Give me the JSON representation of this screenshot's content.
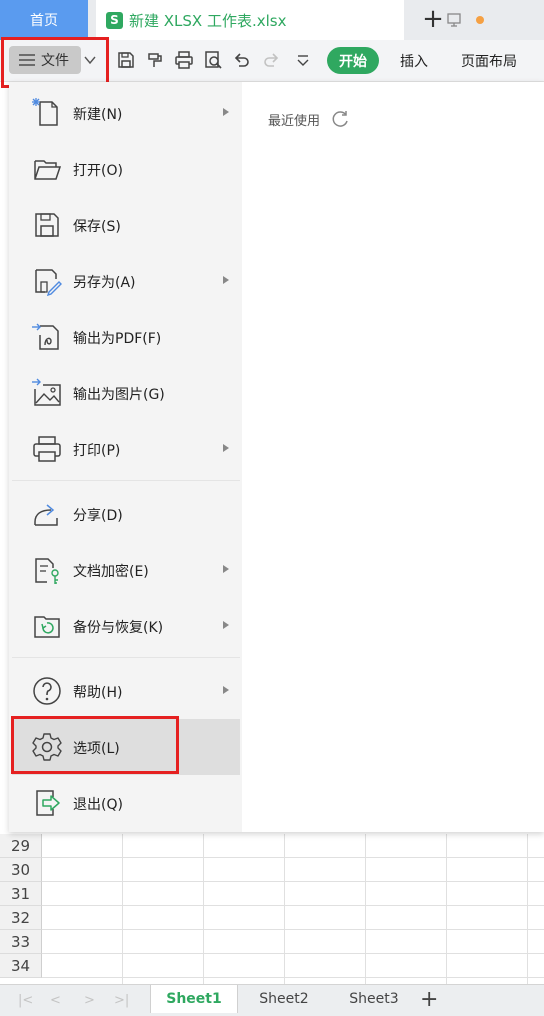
{
  "tabs": {
    "home": "首页",
    "doc_title": "新建 XLSX 工作表.xlsx",
    "doc_logo": "S"
  },
  "toolbar": {
    "file_label": "文件",
    "start_label": "开始",
    "insert_label": "插入",
    "layout_label": "页面布局"
  },
  "file_menu": {
    "recent_label": "最近使用",
    "items": [
      {
        "label": "新建(N)",
        "icon": "new-file-icon",
        "has_submenu": true
      },
      {
        "label": "打开(O)",
        "icon": "folder-open-icon",
        "has_submenu": false
      },
      {
        "label": "保存(S)",
        "icon": "save-icon",
        "has_submenu": false
      },
      {
        "label": "另存为(A)",
        "icon": "save-as-icon",
        "has_submenu": true
      },
      {
        "label": "输出为PDF(F)",
        "icon": "export-pdf-icon",
        "has_submenu": false
      },
      {
        "label": "输出为图片(G)",
        "icon": "export-image-icon",
        "has_submenu": false
      },
      {
        "label": "打印(P)",
        "icon": "printer-icon",
        "has_submenu": true
      },
      {
        "label": "分享(D)",
        "icon": "share-icon",
        "has_submenu": false
      },
      {
        "label": "文档加密(E)",
        "icon": "encrypt-icon",
        "has_submenu": true
      },
      {
        "label": "备份与恢复(K)",
        "icon": "backup-icon",
        "has_submenu": true
      },
      {
        "label": "帮助(H)",
        "icon": "help-icon",
        "has_submenu": true
      },
      {
        "label": "选项(L)",
        "icon": "gear-icon",
        "has_submenu": false,
        "selected": true
      },
      {
        "label": "退出(Q)",
        "icon": "exit-icon",
        "has_submenu": false
      }
    ]
  },
  "rows": [
    "29",
    "30",
    "31",
    "32",
    "33",
    "34"
  ],
  "sheets": [
    {
      "label": "Sheet1",
      "active": true
    },
    {
      "label": "Sheet2",
      "active": false
    },
    {
      "label": "Sheet3",
      "active": false
    }
  ],
  "colors": {
    "accent_green": "#2fa860",
    "home_tab_blue": "#5a9bef",
    "highlight_red": "#e52020"
  }
}
